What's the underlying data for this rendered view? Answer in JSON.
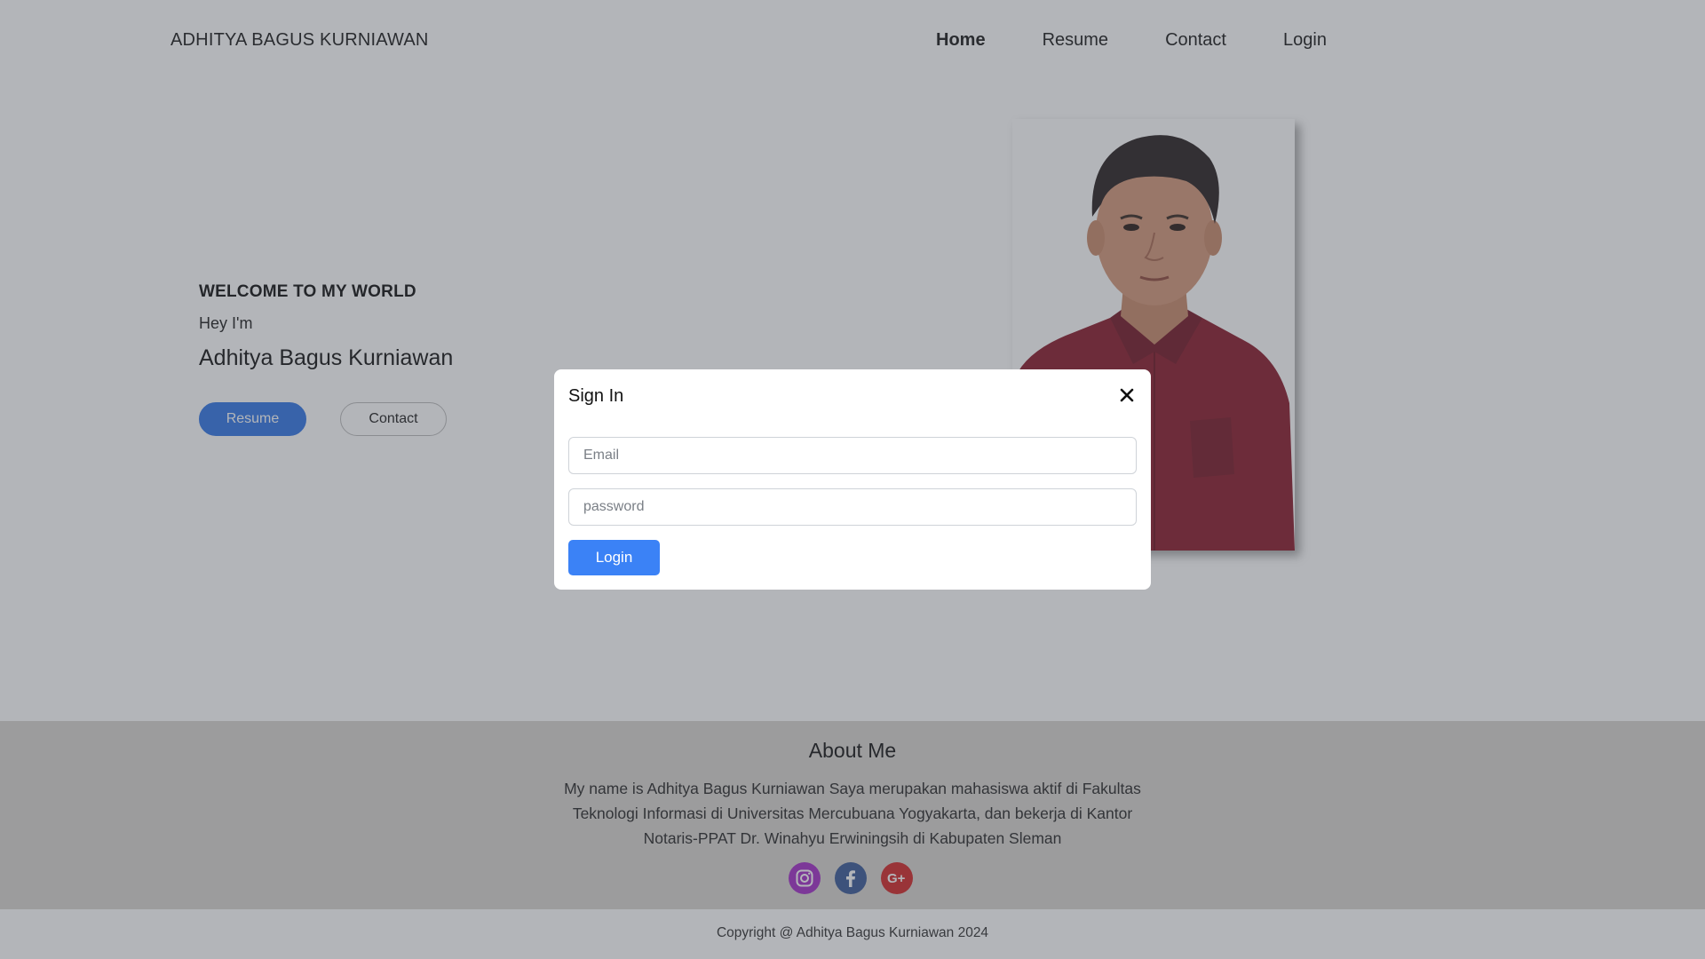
{
  "header": {
    "brand": "ADHITYA BAGUS KURNIAWAN",
    "nav": [
      {
        "label": "Home",
        "active": true
      },
      {
        "label": "Resume",
        "active": false
      },
      {
        "label": "Contact",
        "active": false
      },
      {
        "label": "Login",
        "active": false
      }
    ]
  },
  "hero": {
    "welcome": "WELCOME TO MY WORLD",
    "greeting": "Hey I'm",
    "name": "Adhitya Bagus Kurniawan",
    "resume_label": "Resume",
    "contact_label": "Contact"
  },
  "about": {
    "title": "About Me",
    "body": "My name is Adhitya Bagus Kurniawan Saya merupakan mahasiswa aktif di Fakultas Teknologi Informasi di Universitas Mercubuana Yogyakarta, dan bekerja di Kantor Notaris-PPAT Dr. Winahyu Erwiningsih di Kabupaten Sleman",
    "social": [
      {
        "icon": "instagram-icon",
        "color": "#a330c8"
      },
      {
        "icon": "facebook-icon",
        "color": "#3b5b98"
      },
      {
        "icon": "google-plus-icon",
        "color": "#d42828"
      }
    ]
  },
  "footer": {
    "copyright": "Copyright @ Adhitya Bagus Kurniawan 2024"
  },
  "modal": {
    "title": "Sign In",
    "email_placeholder": "Email",
    "password_placeholder": "password",
    "login_label": "Login",
    "close_icon": "close-icon"
  },
  "colors": {
    "primary": "#3b82f6",
    "resume_button": "#3277e6",
    "shirt": "#8a1c2c",
    "about_bg": "#d9d5d0"
  }
}
